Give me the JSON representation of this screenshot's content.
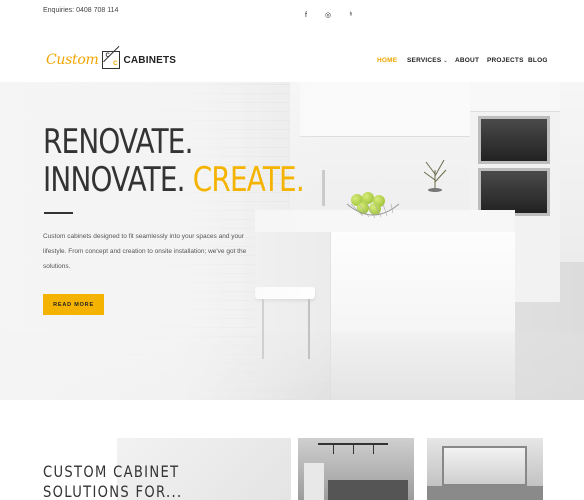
{
  "topbar": {
    "enquiries": "Enquiries: 0408 708 114",
    "social": [
      {
        "icon": "facebook-icon",
        "glyph": "f"
      },
      {
        "icon": "instagram-icon",
        "glyph": "◎"
      },
      {
        "icon": "houzz-icon",
        "glyph": "ʰ"
      }
    ]
  },
  "header": {
    "logo_script": "Custom",
    "logo_mark_1": "C",
    "logo_mark_2": "C",
    "logo_text": "CABINETS",
    "nav": [
      {
        "label": "HOME",
        "active": true
      },
      {
        "label": "SERVICES",
        "has_dropdown": true
      },
      {
        "label": "ABOUT"
      },
      {
        "label": "PROJECTS"
      },
      {
        "label": "BLOG"
      }
    ],
    "dropdown_glyph": "⌄"
  },
  "hero": {
    "line1": "RENOVATE.",
    "line2_prefix": "INNOVATE. ",
    "line2_accent": "CREATE.",
    "description": "Custom cabinets designed to fit seamlessly into your spaces and your lifestyle. From concept and creation to onsite installation; we've got the solutions.",
    "button_label": "READ MORE"
  },
  "section": {
    "title_line1": "CUSTOM CABINET",
    "title_line2": "SOLUTIONS FOR..."
  },
  "colors": {
    "accent": "#f5b301",
    "nav_active": "#f0a500",
    "text_dark": "#333333"
  }
}
